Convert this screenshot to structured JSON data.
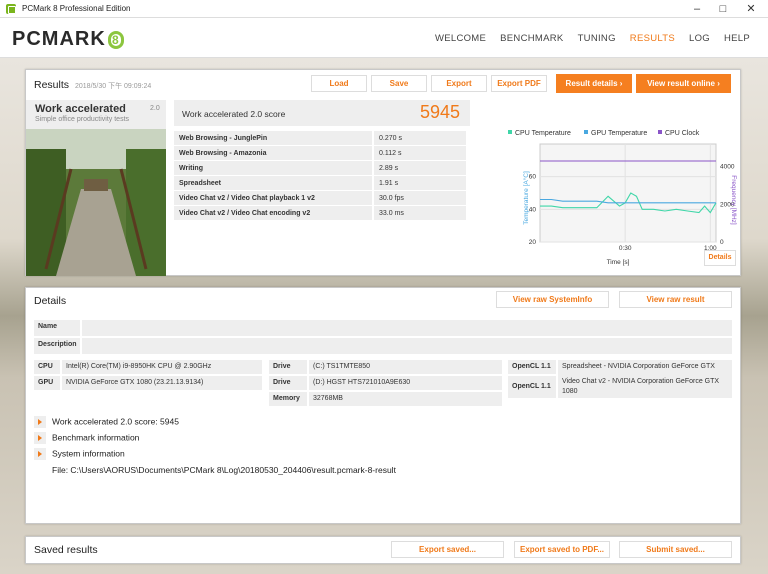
{
  "window": {
    "title": "PCMark 8 Professional Edition"
  },
  "nav": {
    "logo_text": "PCMARK",
    "logo_num": "8",
    "items": [
      "WELCOME",
      "BENCHMARK",
      "TUNING",
      "RESULTS",
      "LOG",
      "HELP"
    ]
  },
  "results": {
    "title": "Results",
    "timestamp": "2018/5/30 下午 09:09:24",
    "buttons": {
      "load": "Load",
      "save": "Save",
      "export": "Export",
      "export_pdf": "Export PDF",
      "result_details": "Result details",
      "view_online": "View result online"
    },
    "test": {
      "name": "Work accelerated",
      "version": "2.0",
      "subtitle": "Simple office productivity tests"
    },
    "score_label": "Work accelerated 2.0 score",
    "score": "5945",
    "rows": [
      {
        "label": "Web Browsing - JunglePin",
        "value": "0.270 s"
      },
      {
        "label": "Web Browsing - Amazonia",
        "value": "0.112 s"
      },
      {
        "label": "Writing",
        "value": "2.89 s"
      },
      {
        "label": "Spreadsheet",
        "value": "1.91 s"
      },
      {
        "label": "Video Chat v2 / Video Chat playback 1 v2",
        "value": "30.0 fps"
      },
      {
        "label": "Video Chat v2 / Video Chat encoding v2",
        "value": "33.0 ms"
      }
    ],
    "details_btn": "Details"
  },
  "chart_data": {
    "type": "line",
    "legend": [
      "CPU Temperature",
      "GPU Temperature",
      "CPU Clock"
    ],
    "colors": {
      "cpu_temp": "#3fd6a8",
      "gpu_temp": "#4aa8e0",
      "cpu_clock": "#8a55c8"
    },
    "xlabel": "Time [s]",
    "ylabel_left": "Temperature [A°C]",
    "ylabel_right": "Frequency [MHz]",
    "x_ticks": [
      "0:30",
      "1:00"
    ],
    "y_left_ticks": [
      "20",
      "40",
      "60"
    ],
    "y_right_ticks": [
      "0",
      "2000",
      "4000"
    ],
    "xlim": [
      0,
      62
    ],
    "ylim_left": [
      20,
      80
    ],
    "ylim_right": [
      0,
      5200
    ],
    "x": [
      0,
      4,
      8,
      12,
      16,
      20,
      24,
      26,
      28,
      30,
      32,
      34,
      36,
      40,
      44,
      48,
      52,
      56,
      58,
      60,
      62
    ],
    "series": [
      {
        "name": "CPU Temperature",
        "values": [
          42,
          42,
          41,
          41,
          41,
          41,
          48,
          45,
          42,
          44,
          50,
          48,
          40,
          40,
          39,
          40,
          39,
          38,
          42,
          38,
          44
        ]
      },
      {
        "name": "GPU Temperature",
        "values": [
          46,
          46,
          45,
          45,
          45,
          45,
          44,
          44,
          44,
          44,
          44,
          44,
          44,
          44,
          44,
          44,
          44,
          44,
          44,
          44,
          44
        ]
      },
      {
        "name": "CPU Clock",
        "values": [
          4300,
          4300,
          4300,
          4300,
          4300,
          4300,
          4300,
          4300,
          4300,
          4300,
          4300,
          4300,
          4300,
          4300,
          4300,
          4300,
          4300,
          4300,
          4300,
          4300,
          4300
        ]
      }
    ]
  },
  "details": {
    "title": "Details",
    "btn_sysinfo": "View raw SystemInfo",
    "btn_raw": "View raw result",
    "name_label": "Name",
    "desc_label": "Description",
    "cpu_label": "CPU",
    "cpu": "Intel(R) Core(TM) i9-8950HK CPU @ 2.90GHz",
    "gpu_label": "GPU",
    "gpu": "NVIDIA GeForce GTX 1080 (23.21.13.9134)",
    "drive_label": "Drive",
    "drive1": "(C:) TS1TMTE850",
    "drive2": "(D:) HGST HTS721010A9E630",
    "mem_label": "Memory",
    "memory": "32768MB",
    "opencl_label": "OpenCL 1.1",
    "opencl1": "Spreadsheet - NVIDIA Corporation GeForce GTX 1080",
    "opencl2": "Video Chat v2 - NVIDIA Corporation GeForce GTX 1080",
    "expanders": [
      "Work accelerated 2.0 score: 5945",
      "Benchmark information",
      "System information"
    ],
    "file": "File: C:\\Users\\AORUS\\Documents\\PCMark 8\\Log\\20180530_204406\\result.pcmark-8-result"
  },
  "saved": {
    "title": "Saved results",
    "btn_export": "Export saved...",
    "btn_pdf": "Export saved to PDF...",
    "btn_submit": "Submit saved..."
  }
}
